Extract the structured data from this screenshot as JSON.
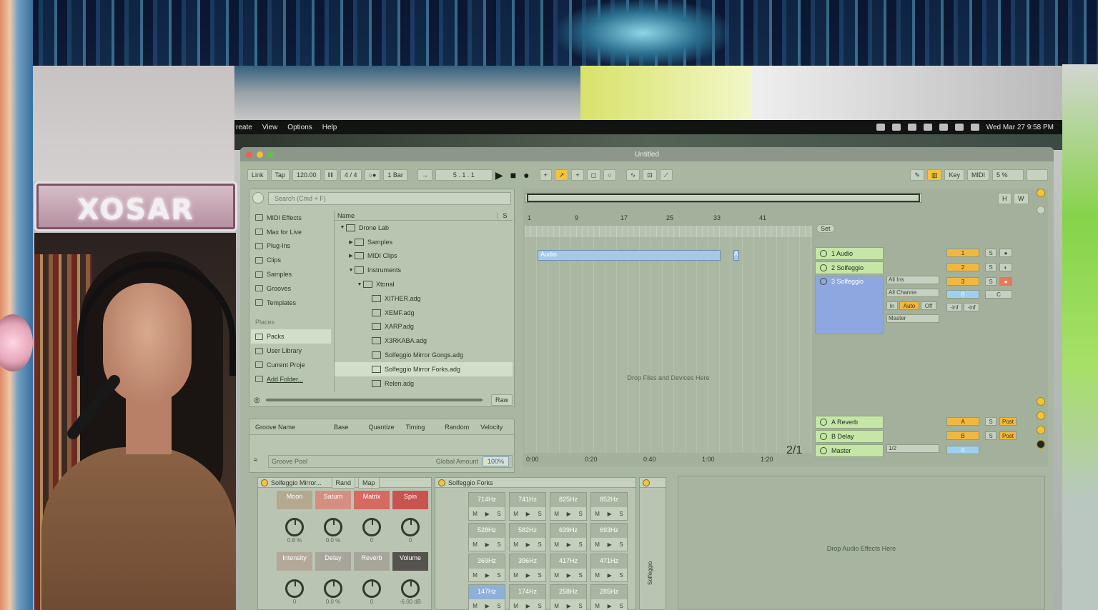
{
  "logo": "XOSAR",
  "menubar": {
    "items": [
      "reate",
      "View",
      "Options",
      "Help"
    ],
    "clock": "Wed Mar 27  9:58 PM"
  },
  "window": {
    "title": "Untitled"
  },
  "toolbar": {
    "link": "Link",
    "tap": "Tap",
    "tempo": "120.00",
    "sig": "4 / 4",
    "quant": "1 Bar",
    "pos": "5 .  1 .  1",
    "key": "Key",
    "midi": "MIDI",
    "cpu": "5 %"
  },
  "browser": {
    "search_placeholder": "Search (Cmd + F)",
    "categories": [
      "MIDI Effects",
      "Max for Live",
      "Plug-Ins",
      "Clips",
      "Samples",
      "Grooves",
      "Templates"
    ],
    "places_header": "Places",
    "places": [
      "Packs",
      "User Library",
      "Current Proje",
      "Add Folder..."
    ],
    "name_col": "Name",
    "s_col": "S",
    "files": [
      {
        "label": "Drone Lab",
        "indent": 0,
        "tri": "▼"
      },
      {
        "label": "Samples",
        "indent": 1,
        "tri": "▶"
      },
      {
        "label": "MIDI Clips",
        "indent": 1,
        "tri": "▶"
      },
      {
        "label": "Instruments",
        "indent": 1,
        "tri": "▼"
      },
      {
        "label": "Xtonal",
        "indent": 2,
        "tri": "▼"
      },
      {
        "label": "XITHER.adg",
        "indent": 3,
        "tri": ""
      },
      {
        "label": "XEMF.adg",
        "indent": 3,
        "tri": ""
      },
      {
        "label": "XARP.adg",
        "indent": 3,
        "tri": ""
      },
      {
        "label": "X3RKABA.adg",
        "indent": 3,
        "tri": ""
      },
      {
        "label": "Solfeggio Mirror Gongs.adg",
        "indent": 3,
        "tri": ""
      },
      {
        "label": "Solfeggio Mirror Forks.adg",
        "indent": 3,
        "tri": ""
      },
      {
        "label": "Relen.adg",
        "indent": 3,
        "tri": ""
      }
    ],
    "raw": "Raw"
  },
  "groove": {
    "cols": [
      "Groove Name",
      "Base",
      "Quantize",
      "Timing",
      "Random",
      "Velocity"
    ],
    "pool": "Groove Pool",
    "amount_label": "Global Amount",
    "amount": "100%"
  },
  "arrangement": {
    "ruler": [
      "1",
      "9",
      "17",
      "25",
      "33",
      "41"
    ],
    "times": [
      "0:00",
      "0:20",
      "0:40",
      "1:00",
      "1:20"
    ],
    "clip": "Audio",
    "clip2": "A",
    "drop": "Drop Files and Devices Here",
    "frac": "2/1",
    "set": "Set"
  },
  "tracks": [
    {
      "name": "1 Audio",
      "num": "1"
    },
    {
      "name": "2 Solfeggio",
      "num": "2"
    },
    {
      "name": "3 Solfeggio",
      "num": "3"
    },
    {
      "name": "A Reverb",
      "num": "A"
    },
    {
      "name": "B Delay",
      "num": "B"
    },
    {
      "name": "Master",
      "num": "0"
    }
  ],
  "io": {
    "in": "All Ins",
    "chan": "All Channe",
    "in_btn": "In",
    "auto": "Auto",
    "off": "Off",
    "out": "Master",
    "master_out": "1/2",
    "inf": "-inf",
    "c": "C",
    "post": "Post",
    "s": "S",
    "h": "H",
    "w": "W"
  },
  "rack": {
    "title": "Solfeggio Mirror...",
    "rand": "Rand",
    "map": "Map",
    "macros": [
      {
        "name": "Moon",
        "val": "0.8 %",
        "color": "#b3a98f"
      },
      {
        "name": "Saturn",
        "val": "0.0 %",
        "color": "#d38f82"
      },
      {
        "name": "Matrix",
        "val": "0",
        "color": "#d46a62"
      },
      {
        "name": "Spin",
        "val": "0",
        "color": "#c85450"
      },
      {
        "name": "Intensity",
        "val": "0",
        "color": "#b3a99a"
      },
      {
        "name": "Delay",
        "val": "0.0 %",
        "color": "#a6a69b"
      },
      {
        "name": "Reverb",
        "val": "0",
        "color": "#a6a69b"
      },
      {
        "name": "Volume",
        "val": "-6.00 dB",
        "color": "#55534e"
      }
    ]
  },
  "forks": {
    "title": "Solfeggio Forks",
    "pads": [
      "714Hz",
      "741Hz",
      "825Hz",
      "852Hz",
      "528Hz",
      "582Hz",
      "639Hz",
      "693Hz",
      "369Hz",
      "396Hz",
      "417Hz",
      "471Hz",
      "147Hz",
      "174Hz",
      "258Hz",
      "285Hz"
    ],
    "m": "M",
    "p": "▶",
    "s": "S"
  },
  "chain_label": "Solfeggio",
  "fx_drop": "Drop Audio Effects Here",
  "colors": {
    "accent": "#f2c43a",
    "clip": "#a8c8e8",
    "track_sel": "#8fa7e0",
    "track": "#c6e6a8"
  }
}
